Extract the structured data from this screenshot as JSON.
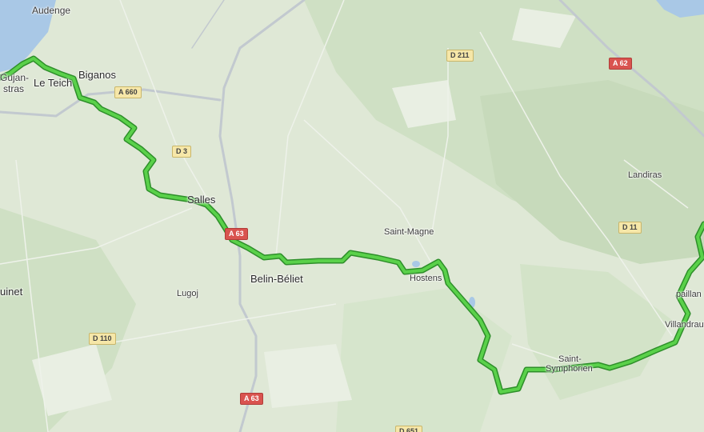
{
  "map": {
    "colors": {
      "background": "#dfe8d6",
      "forest": "#cfe0c4",
      "water": "#a9c8e6",
      "road": "#c2c9cf",
      "route": "#5ad14a",
      "route_outline": "#2e8f2a"
    },
    "places": {
      "audenge": "Audenge",
      "biganos": "Biganos",
      "le_teich": "Le Teich",
      "gujan": "Gujan-",
      "mestras": "stras",
      "salles": "Salles",
      "belin_beliet": "Belin-Béliet",
      "lugos": "Lugoj",
      "saint_magne": "Saint-Magne",
      "hostens": "Hostens",
      "saint_symphorien_1": "Saint-",
      "saint_symphorien_2": "Symphorien",
      "landiras": "Landiras",
      "villandraut": "Villandraut",
      "uzeste": "paillan",
      "marcheprime": "uinet"
    },
    "roads": {
      "a660": "A 660",
      "d3": "D 3",
      "a63_top": "A 63",
      "a63_bottom": "A 63",
      "d211": "D 211",
      "a62": "A 62",
      "d11": "D 11",
      "d110": "D 110",
      "d651": "D 651"
    }
  }
}
